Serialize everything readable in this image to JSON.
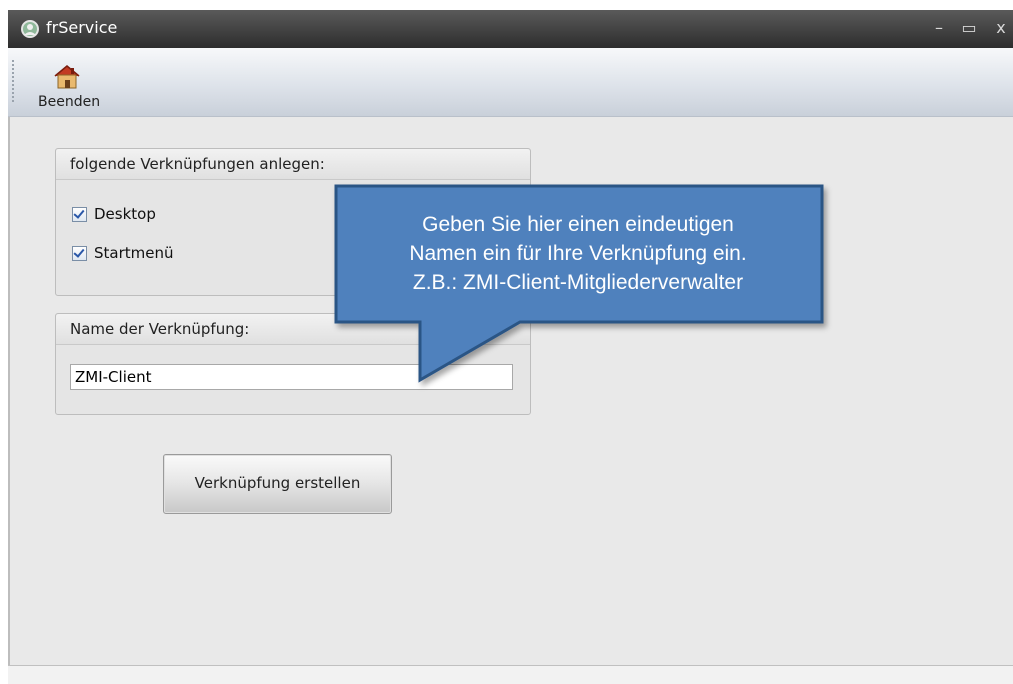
{
  "window": {
    "title": "frService",
    "minimize": "–",
    "maximize": "▭",
    "close": "x"
  },
  "toolbar": {
    "beenden_label": "Beenden",
    "beenden_icon": "home-icon"
  },
  "shortcuts_group": {
    "header": "folgende Verknüpfungen anlegen:",
    "desktop": {
      "label": "Desktop",
      "checked": true
    },
    "startmenu": {
      "label": "Startmenü",
      "checked": true
    }
  },
  "name_group": {
    "header": "Name der Verknüpfung:",
    "value": "ZMI-Client"
  },
  "create_button": {
    "label": "Verknüpfung erstellen"
  },
  "callout": {
    "line1": "Geben Sie hier einen eindeutigen",
    "line2": "Namen ein für Ihre Verknüpfung ein.",
    "line3": "Z.B.: ZMI-Client-Mitgliederverwalter",
    "fill": "#4f81bd",
    "stroke": "#2c5485"
  }
}
